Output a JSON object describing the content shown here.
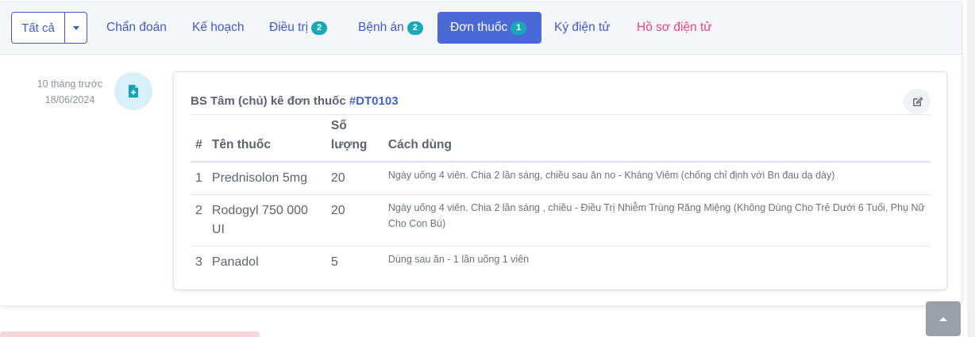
{
  "filter": {
    "label": "Tất cả"
  },
  "tabs": [
    {
      "label": "Chẩn đoán",
      "badge": null
    },
    {
      "label": "Kế hoạch",
      "badge": null
    },
    {
      "label": "Điều trị",
      "badge": "2"
    },
    {
      "label": "Bệnh án",
      "badge": "2"
    },
    {
      "label": "Đơn thuốc",
      "badge": "1",
      "active": true
    },
    {
      "label": "Ký điện tử",
      "badge": null
    },
    {
      "label": "Hồ sơ điện tử",
      "badge": null
    }
  ],
  "timeline": {
    "relative_time": "10 tháng trước",
    "date": "18/06/2024",
    "icon": "file-add-icon"
  },
  "prescription": {
    "title_prefix": "BS Tâm (chủ) kê đơn thuốc ",
    "code": "#DT0103",
    "columns": {
      "index": "#",
      "name": "Tên thuốc",
      "qty_line1": "Số",
      "qty_line2": "lượng",
      "usage": "Cách dùng"
    },
    "rows": [
      {
        "index": "1",
        "name": "Prednisolon 5mg",
        "qty": "20",
        "usage": "Ngày uống 4 viên. Chia 2 lần sáng, chiều sau ăn no - Kháng Viêm (chống chỉ định với Bn đau dạ dày)"
      },
      {
        "index": "2",
        "name": "Rodogyl 750 000 UI",
        "qty": "20",
        "usage": "Ngày uống 4 viên. Chia 2 lần sáng , chiều - Điều Trị Nhiễm Trùng Răng Miệng (Không Dùng Cho Trẻ Dưới 6 Tuổi, Phụ Nữ Cho Con Bú)"
      },
      {
        "index": "3",
        "name": "Panadol",
        "qty": "5",
        "usage": "Dùng sau ăn - 1 lần uống 1 viên"
      }
    ]
  },
  "colors": {
    "accent": "#4a68d6",
    "badge": "#1aa8b8",
    "pink_tab": "#e8467c",
    "text": "#5b6373"
  }
}
